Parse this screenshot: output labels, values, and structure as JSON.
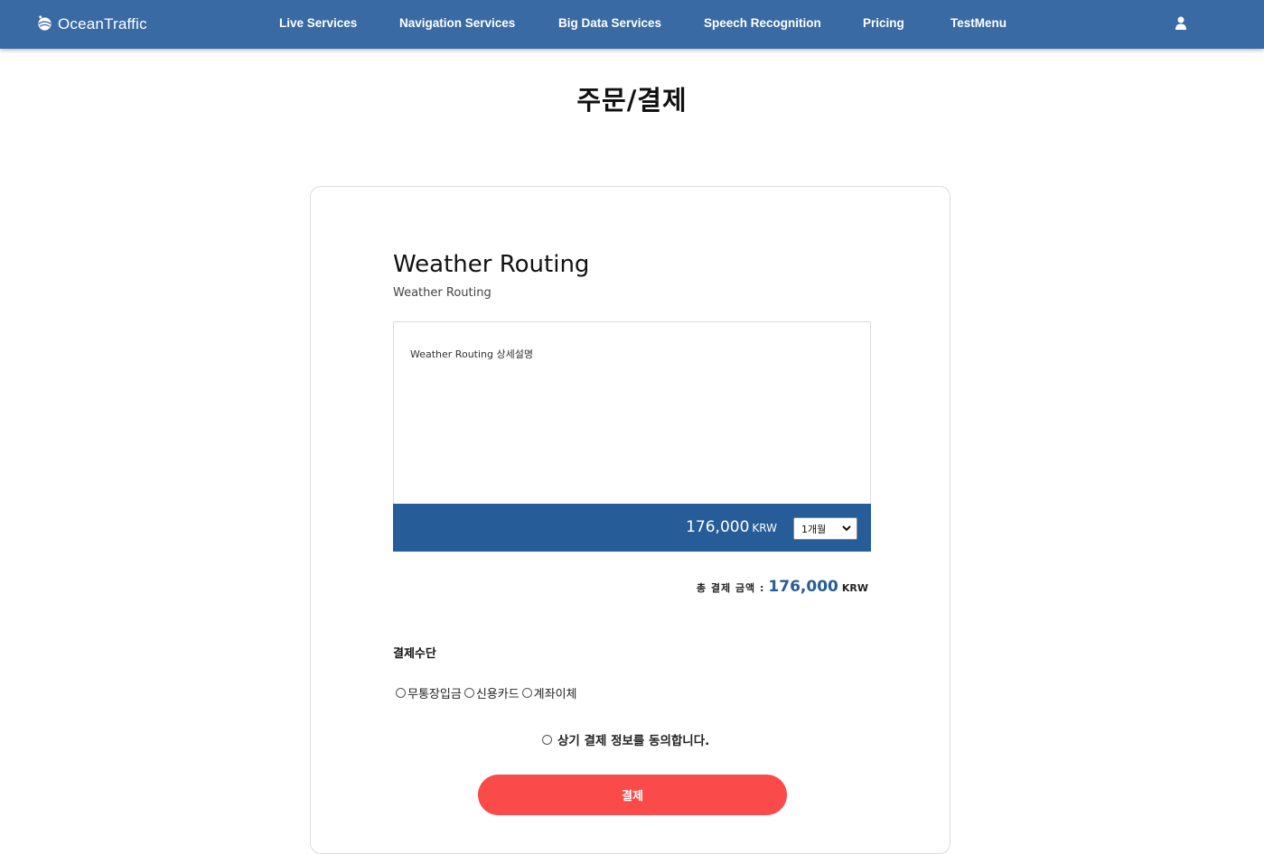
{
  "brand": {
    "name": "OceanTraffic",
    "logo_icon": "ship-globe-icon"
  },
  "nav": {
    "items": [
      {
        "label": "Live Services"
      },
      {
        "label": "Navigation Services"
      },
      {
        "label": "Big Data Services"
      },
      {
        "label": "Speech Recognition"
      },
      {
        "label": "Pricing"
      },
      {
        "label": "TestMenu"
      }
    ],
    "user_icon": "user-icon"
  },
  "page": {
    "title": "주문/결제"
  },
  "product": {
    "name": "Weather Routing",
    "subtitle": "Weather Routing",
    "description": "Weather Routing 상세설명",
    "price": "176,000",
    "currency": "KRW",
    "period_selected": "1개월"
  },
  "total": {
    "label": "총 결제 금액 :",
    "amount": "176,000",
    "currency": "KRW"
  },
  "payment": {
    "label": "결제수단",
    "options": [
      {
        "label": "무통장입금"
      },
      {
        "label": "신용카드"
      },
      {
        "label": "계좌이체"
      }
    ]
  },
  "agreement": {
    "label": "상기 결제 정보를 동의합니다."
  },
  "submit": {
    "label": "결제"
  },
  "colors": {
    "navbar": "#3a6aa3",
    "price_bar": "#265c97",
    "accent_text": "#265c97",
    "pay_button": "#fb4a4a"
  }
}
